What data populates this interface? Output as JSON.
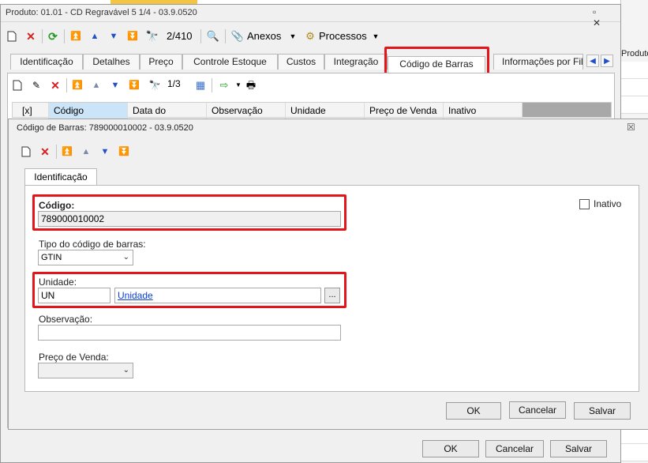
{
  "background": {
    "right_label": "Produto"
  },
  "main_window": {
    "title": "Produto: 01.01 - CD Regravável 5 1/4 - 03.9.0520",
    "controls": "▫ ✕",
    "toolbar": {
      "record_counter": "2/410",
      "anexos_label": "Anexos",
      "processos_label": "Processos"
    },
    "tabs": [
      {
        "label": "Identificação"
      },
      {
        "label": "Detalhes"
      },
      {
        "label": "Preço"
      },
      {
        "label": "Controle Estoque"
      },
      {
        "label": "Custos"
      },
      {
        "label": "Integração"
      },
      {
        "label": "Código de Barras"
      },
      {
        "label": "Informações por Fili"
      }
    ],
    "subtoolbar": {
      "record_counter": "1/3"
    },
    "grid_columns": [
      "[x]",
      "Código",
      "Data do",
      "Observação",
      "Unidade",
      "Preço de Venda",
      "Inativo"
    ],
    "buttons": {
      "ok": "OK",
      "cancel": "Cancelar",
      "save": "Salvar"
    }
  },
  "dialog": {
    "title": "Código de Barras: 789000010002 - 03.9.0520",
    "close": "☒",
    "tab": "Identificação",
    "fields": {
      "codigo_label": "Código:",
      "codigo_value": "789000010002",
      "tipo_label": "Tipo do código de barras:",
      "tipo_value": "GTIN",
      "unidade_label": "Unidade:",
      "unidade_value": "UN",
      "unidade_link": "Unidade",
      "unidade_lookup": "...",
      "observacao_label": "Observação:",
      "observacao_value": "",
      "preco_label": "Preço de Venda:",
      "preco_value": "",
      "inativo_label": "Inativo"
    },
    "buttons": {
      "ok": "OK",
      "cancel": "Cancelar",
      "save": "Salvar"
    }
  },
  "colors": {
    "highlight": "#e3151b",
    "link": "#0b3fd6",
    "selected_column": "#cce4f7"
  }
}
